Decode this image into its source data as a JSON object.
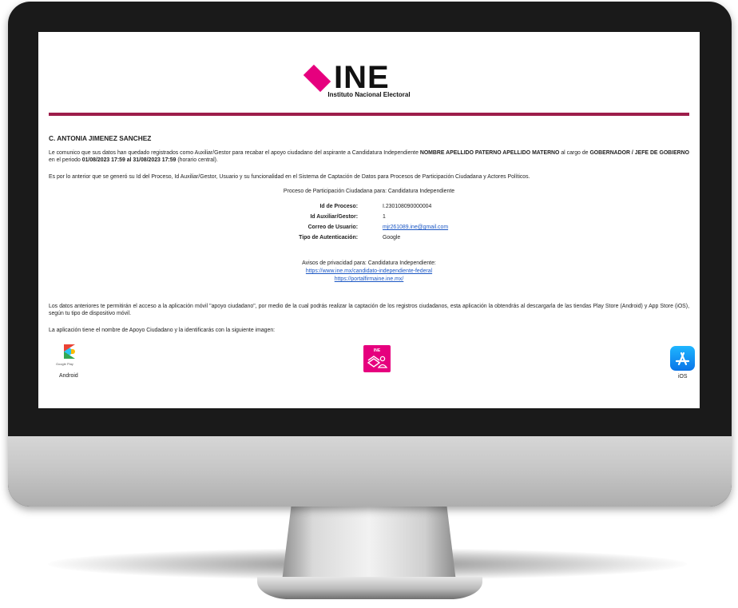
{
  "logo": {
    "wordmark": "INE",
    "subtitle": "Instituto Nacional Electoral",
    "accent_color": "#e6007e",
    "rule_color": "#9d1d4a"
  },
  "recipient": "C. ANTONIA JIMENEZ SANCHEZ",
  "paragraph1": {
    "t1": "Le comunico que sus datos han quedado registrados como Auxiliar/Gestor para recabar el apoyo ciudadano del aspirante a Candidatura Independiente ",
    "b1": "NOMBRE APELLIDO PATERNO APELLIDO MATERNO",
    "t2": " al cargo de ",
    "b2": "GOBERNADOR / JEFE DE GOBIERNO",
    "t3": " en el periodo ",
    "b3": "01/08/2023 17:59 al 31/08/2023 17:59",
    "t4": " (horario central)."
  },
  "paragraph2": "Es por lo anterior que se generó su Id del Proceso, Id Auxiliar/Gestor, Usuario y su funcionalidad en el Sistema de Captación de Datos para Procesos de Participación Ciudadana y Actores Políticos.",
  "process_title": "Proceso de Participación Ciudadana para: Candidatura Independiente",
  "details": [
    {
      "label": "Id de Proceso:",
      "value": "I.230108090000004"
    },
    {
      "label": "Id Auxiliar/Gestor:",
      "value": "1"
    },
    {
      "label": "Correo de Usuario:",
      "value": "mjr261089.ine@gmail.com"
    },
    {
      "label": "Tipo de Autenticación:",
      "value": "Google"
    }
  ],
  "privacy": {
    "title": "Avisos de privacidad para: Candidatura Independiente:",
    "link1": "https://www.ine.mx/candidato-independiente-federal",
    "link2": "https://portalfirmaine.ine.mx/"
  },
  "paragraph3": "Los datos anteriores te permitirán el acceso a la aplicación móvil \"apoyo ciudadano\", por medio de la cual podrás realizar la captación de los registros ciudadanos, esta aplicación la obtendrás al descargarla de las tiendas Play Store (Android) y App Store (iOS), según tu tipo de dispositivo móvil.",
  "paragraph4": "La aplicación tiene el nombre de Apoyo Ciudadano y la identificarás con la siguiente imagen:",
  "apps": {
    "android_caption": "Google Play",
    "android_label": "Android",
    "ine_app_mini": "INE",
    "ios_label": "iOS",
    "ios_icon": "app-store-icon",
    "android_icon": "google-play-icon",
    "ine_icon": "apoyo-ciudadano-icon"
  }
}
